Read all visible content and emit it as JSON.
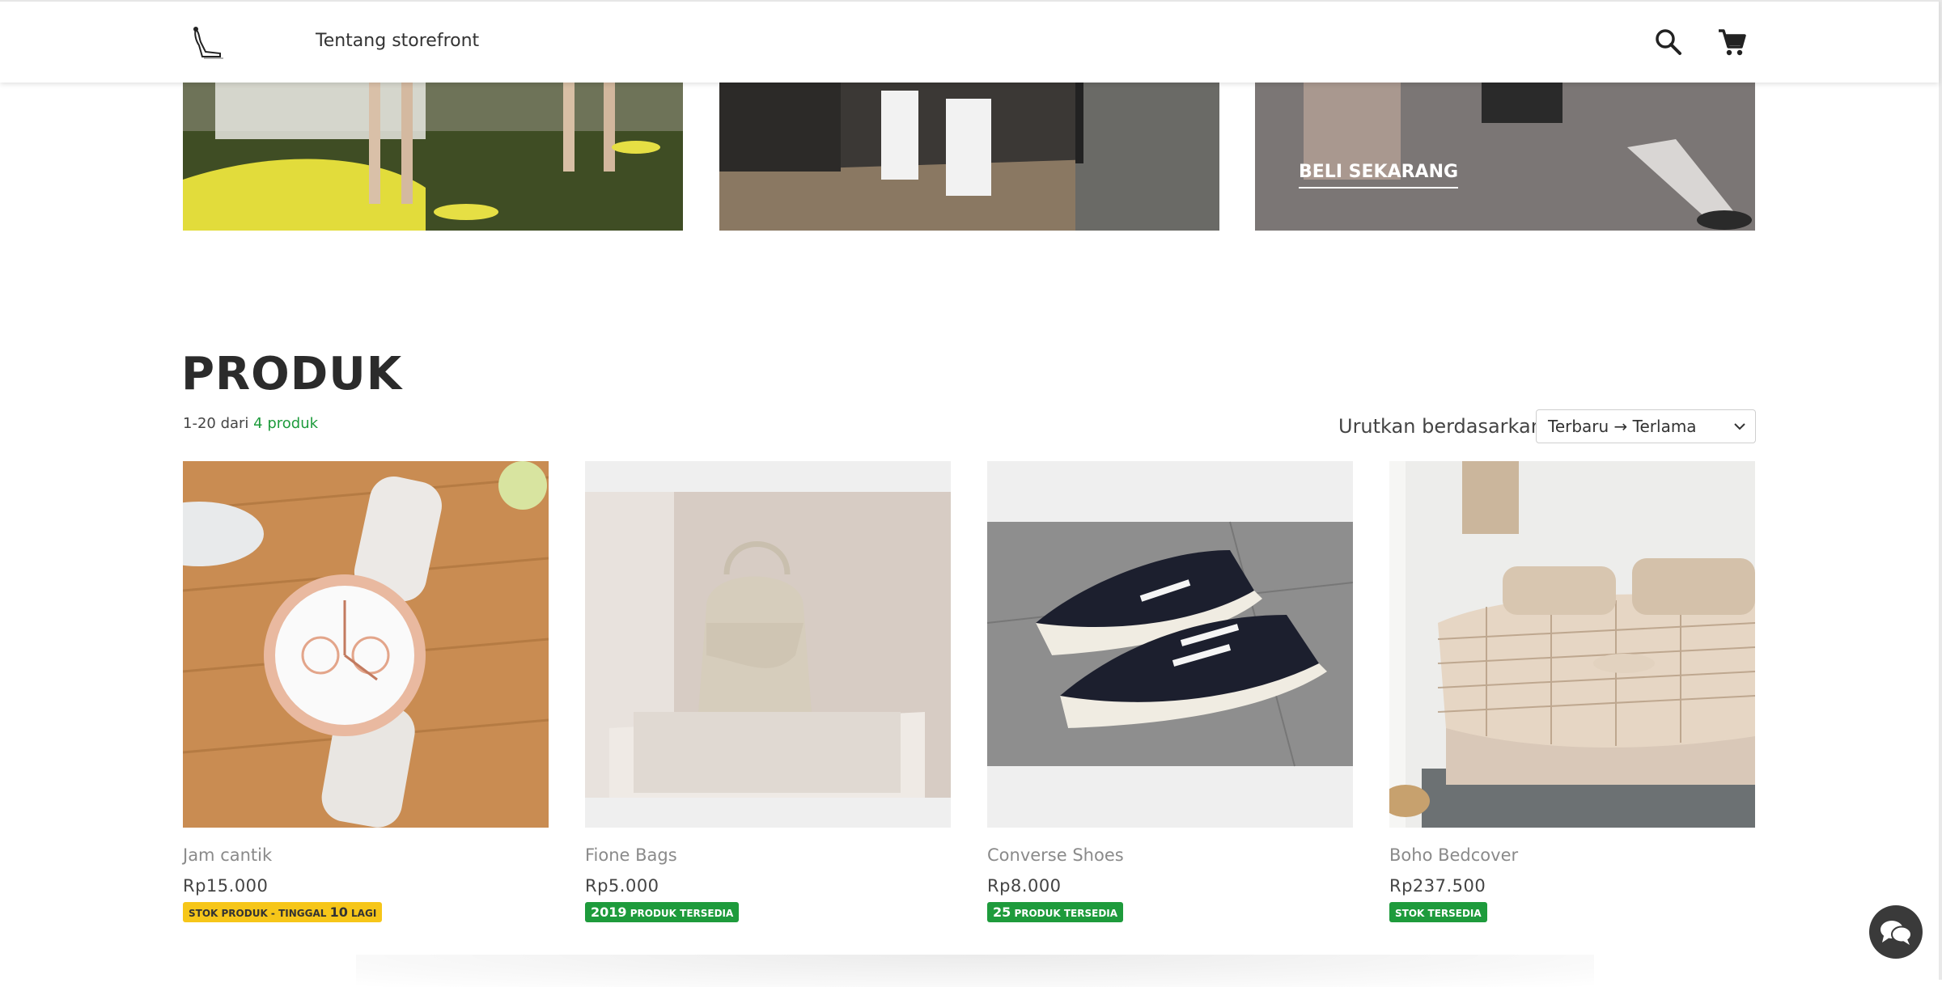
{
  "header": {
    "nav_link": "Tentang storefront",
    "icons": [
      "search-icon",
      "cart-icon"
    ]
  },
  "banners": {
    "cta_label": "BELI SEKARANG"
  },
  "products_section": {
    "title": "PRODUK",
    "count_prefix": "1-20 dari ",
    "count_highlight": "4 produk",
    "sort_label": "Urutkan berdasarkan:",
    "sort_selected": "Terbaru → Terlama"
  },
  "products": [
    {
      "name": "Jam cantik",
      "price": "Rp15.000",
      "badge_pre": "STOK PRODUK - TINGGAL ",
      "badge_num": "10",
      "badge_post": " LAGI",
      "badge_color": "#f6c619"
    },
    {
      "name": "Fione Bags",
      "price": "Rp5.000",
      "badge_pre": "",
      "badge_num": "2019",
      "badge_post": " PRODUK TERSEDIA",
      "badge_color": "#1e9b3c"
    },
    {
      "name": "Converse Shoes",
      "price": "Rp8.000",
      "badge_pre": "",
      "badge_num": "25",
      "badge_post": " PRODUK TERSEDIA",
      "badge_color": "#1e9b3c"
    },
    {
      "name": "Boho Bedcover",
      "price": "Rp237.500",
      "badge_pre": "STOK TERSEDIA",
      "badge_num": "",
      "badge_post": "",
      "badge_color": "#1e9b3c"
    }
  ],
  "colors": {
    "accent_green": "#1e9b3c",
    "low_stock_yellow": "#f6c619"
  }
}
